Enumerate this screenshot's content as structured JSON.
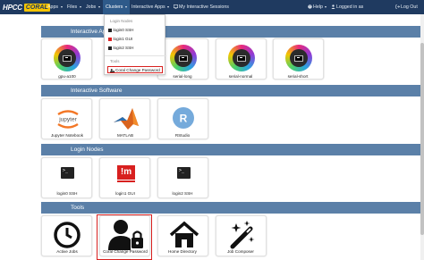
{
  "navbar": {
    "brand_prefix": "HPCC",
    "brand_name": "CORAL",
    "apps": "Apps",
    "files": "Files",
    "jobs": "Jobs",
    "clusters": "Clusters",
    "interactive_apps": "Interactive Apps",
    "my_sessions": "My Interactive Sessions",
    "help": "Help",
    "logged_in": "Logged in as",
    "log_out": "Log Out"
  },
  "clusters_menu": {
    "header_login": "Login Nodes",
    "items": [
      "login0 SSH",
      "login1 GUI",
      "login2 SSH"
    ],
    "header_tools": "Tools",
    "tool_item": "Coral Change Password"
  },
  "sections": {
    "interactive_apps": "Interactive Apps",
    "interactive_software": "Interactive Software",
    "login_nodes": "Login Nodes",
    "tools": "Tools"
  },
  "interactive_apps_tiles": [
    "gpu-a100",
    "serial-long",
    "serial-normal",
    "serial-short"
  ],
  "software_tiles": [
    "Jupyter Notebook",
    "MATLAB",
    "RStudio"
  ],
  "software_logos": {
    "jupyter": "jupyter",
    "rstudio": "R"
  },
  "login_tiles": [
    "login0 SSH",
    "login1 GUI",
    "login2 SSH"
  ],
  "gui_logo": "!m",
  "tools_tiles": [
    "Active Jobs",
    "Coral Change Password",
    "Home Directory",
    "Job Composer"
  ],
  "colors": {
    "navbar": "#1f3a60",
    "section": "#5b80a8",
    "brand_accent": "#f5c400",
    "highlight": "#d8201f"
  }
}
